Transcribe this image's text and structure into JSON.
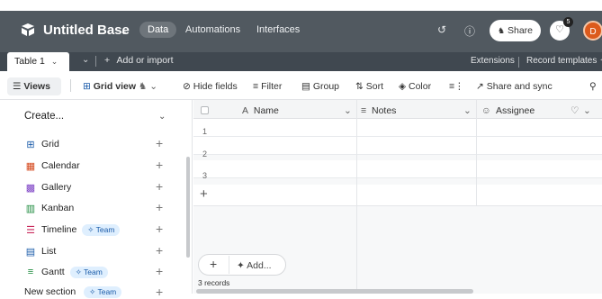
{
  "header": {
    "base_title": "Untitled Base",
    "tabs": [
      {
        "label": "Data",
        "active": true
      },
      {
        "label": "Automations",
        "active": false
      },
      {
        "label": "Interfaces",
        "active": false
      }
    ],
    "share_label": "Share",
    "notification_count": "5",
    "avatar_initial": "D",
    "colors": {
      "bar": "#515960",
      "tabs_bar": "#404850",
      "avatar": "#dc5a1c"
    }
  },
  "tabsbar": {
    "current_table": "Table 1",
    "add_import": "Add or import",
    "extensions": "Extensions",
    "record_templates": "Record templates"
  },
  "toolbar": {
    "views": "Views",
    "grid_view": "Grid view",
    "hide_fields": "Hide fields",
    "filter": "Filter",
    "group": "Group",
    "sort": "Sort",
    "color": "Color",
    "share_sync": "Share and sync"
  },
  "sidebar": {
    "create_label": "Create...",
    "items": [
      {
        "label": "Grid",
        "icon": "grid-icon",
        "team": false
      },
      {
        "label": "Calendar",
        "icon": "calendar-icon",
        "team": false
      },
      {
        "label": "Gallery",
        "icon": "gallery-icon",
        "team": false
      },
      {
        "label": "Kanban",
        "icon": "kanban-icon",
        "team": false
      },
      {
        "label": "Timeline",
        "icon": "timeline-icon",
        "team": true
      },
      {
        "label": "List",
        "icon": "list-icon",
        "team": false
      },
      {
        "label": "Gantt",
        "icon": "gantt-icon",
        "team": true
      }
    ],
    "team_badge": "Team",
    "new_section": "New section"
  },
  "grid": {
    "columns": [
      {
        "label": "Name",
        "icon": "text-icon"
      },
      {
        "label": "Notes",
        "icon": "notes-icon"
      },
      {
        "label": "Assignee",
        "icon": "user-icon"
      }
    ],
    "rows": [
      "1",
      "2",
      "3"
    ],
    "add_label": "Add...",
    "records_count": "3 records"
  }
}
